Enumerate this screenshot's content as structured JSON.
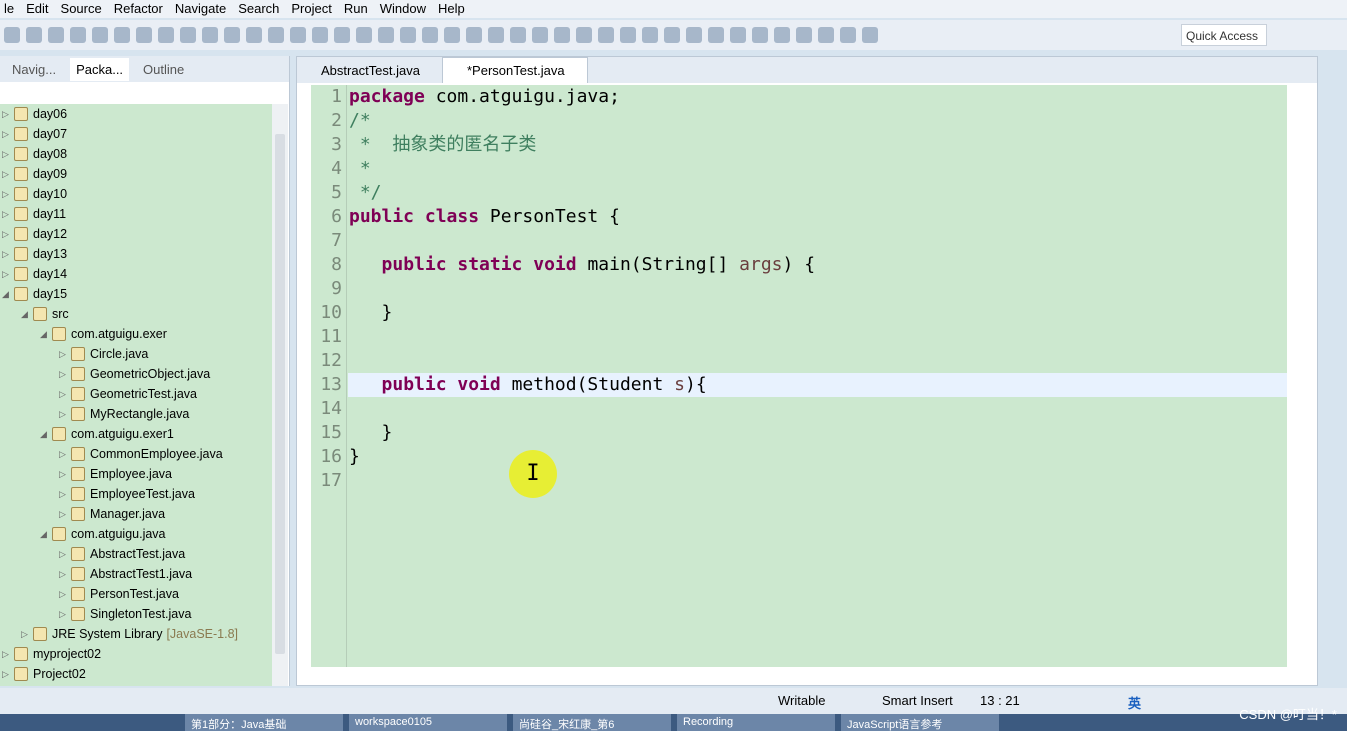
{
  "menu": [
    "le",
    "Edit",
    "Source",
    "Refactor",
    "Navigate",
    "Search",
    "Project",
    "Run",
    "Window",
    "Help"
  ],
  "quick_access": "Quick Access",
  "left_tabs": [
    "Navig...",
    "Packa...",
    "Outline"
  ],
  "tree": [
    {
      "label": "day06",
      "depth": 0,
      "arrow": "▷",
      "icon": "project-icon"
    },
    {
      "label": "day07",
      "depth": 0,
      "arrow": "▷",
      "icon": "project-icon"
    },
    {
      "label": "day08",
      "depth": 0,
      "arrow": "▷",
      "icon": "project-icon"
    },
    {
      "label": "day09",
      "depth": 0,
      "arrow": "▷",
      "icon": "project-icon"
    },
    {
      "label": "day10",
      "depth": 0,
      "arrow": "▷",
      "icon": "project-icon"
    },
    {
      "label": "day11",
      "depth": 0,
      "arrow": "▷",
      "icon": "project-icon"
    },
    {
      "label": "day12",
      "depth": 0,
      "arrow": "▷",
      "icon": "project-icon"
    },
    {
      "label": "day13",
      "depth": 0,
      "arrow": "▷",
      "icon": "project-icon"
    },
    {
      "label": "day14",
      "depth": 0,
      "arrow": "▷",
      "icon": "project-icon"
    },
    {
      "label": "day15",
      "depth": 0,
      "arrow": "◢",
      "icon": "project-icon"
    },
    {
      "label": "src",
      "depth": 1,
      "arrow": "◢",
      "icon": "source-folder-icon"
    },
    {
      "label": "com.atguigu.exer",
      "depth": 2,
      "arrow": "◢",
      "icon": "package-icon"
    },
    {
      "label": "Circle.java",
      "depth": 3,
      "arrow": "▷",
      "icon": "java-file-icon"
    },
    {
      "label": "GeometricObject.java",
      "depth": 3,
      "arrow": "▷",
      "icon": "java-file-icon"
    },
    {
      "label": "GeometricTest.java",
      "depth": 3,
      "arrow": "▷",
      "icon": "java-file-icon"
    },
    {
      "label": "MyRectangle.java",
      "depth": 3,
      "arrow": "▷",
      "icon": "java-file-icon"
    },
    {
      "label": "com.atguigu.exer1",
      "depth": 2,
      "arrow": "◢",
      "icon": "package-icon"
    },
    {
      "label": "CommonEmployee.java",
      "depth": 3,
      "arrow": "▷",
      "icon": "java-file-icon"
    },
    {
      "label": "Employee.java",
      "depth": 3,
      "arrow": "▷",
      "icon": "java-file-icon"
    },
    {
      "label": "EmployeeTest.java",
      "depth": 3,
      "arrow": "▷",
      "icon": "java-file-icon"
    },
    {
      "label": "Manager.java",
      "depth": 3,
      "arrow": "▷",
      "icon": "java-file-icon"
    },
    {
      "label": "com.atguigu.java",
      "depth": 2,
      "arrow": "◢",
      "icon": "package-icon"
    },
    {
      "label": "AbstractTest.java",
      "depth": 3,
      "arrow": "▷",
      "icon": "java-file-icon"
    },
    {
      "label": "AbstractTest1.java",
      "depth": 3,
      "arrow": "▷",
      "icon": "java-file-icon"
    },
    {
      "label": "PersonTest.java",
      "depth": 3,
      "arrow": "▷",
      "icon": "java-file-icon"
    },
    {
      "label": "SingletonTest.java",
      "depth": 3,
      "arrow": "▷",
      "icon": "java-file-icon"
    },
    {
      "label": "JRE System Library",
      "suffix": "[JavaSE-1.8]",
      "depth": 1,
      "arrow": "▷",
      "icon": "library-icon"
    },
    {
      "label": "myproject02",
      "depth": 0,
      "arrow": "▷",
      "icon": "project-icon"
    },
    {
      "label": "Project02",
      "depth": 0,
      "arrow": "▷",
      "icon": "project-icon"
    }
  ],
  "editor_tabs": [
    {
      "label": "AbstractTest.java",
      "active": false
    },
    {
      "label": "*PersonTest.java",
      "active": true
    }
  ],
  "code": [
    [
      [
        "kw",
        "package"
      ],
      [
        "",
        "com.atguigu.java;"
      ]
    ],
    [
      [
        "cm",
        "/*"
      ]
    ],
    [
      [
        "cm",
        " *  抽象类的匿名子类"
      ]
    ],
    [
      [
        "cm",
        " *"
      ]
    ],
    [
      [
        "cm",
        " */"
      ]
    ],
    [
      [
        "kw",
        "public class"
      ],
      [
        "",
        "PersonTest {"
      ]
    ],
    [],
    [
      [
        "",
        "   "
      ],
      [
        "kw",
        "public static void"
      ],
      [
        "",
        "main(String[] "
      ],
      [
        "var",
        "args"
      ],
      [
        "",
        ") {"
      ]
    ],
    [],
    [
      [
        "",
        "   }"
      ]
    ],
    [],
    [],
    [
      [
        "",
        "   "
      ],
      [
        "kw",
        "public void"
      ],
      [
        "",
        "method(Student "
      ],
      [
        "var",
        "s"
      ],
      [
        "",
        "){"
      ]
    ],
    [],
    [
      [
        "",
        "   }"
      ]
    ],
    [
      [
        "",
        "}"
      ]
    ],
    []
  ],
  "cursor_glyph": "I",
  "status": {
    "mode": "Writable",
    "insert": "Smart Insert",
    "position": "13 : 21"
  },
  "ime": "英",
  "taskbar": [
    "第1部分：Java基础",
    "workspace0105",
    "尚硅谷_宋红康_第6",
    "Recording",
    "JavaScript语言参考"
  ],
  "watermark": "CSDN @叮当！*"
}
